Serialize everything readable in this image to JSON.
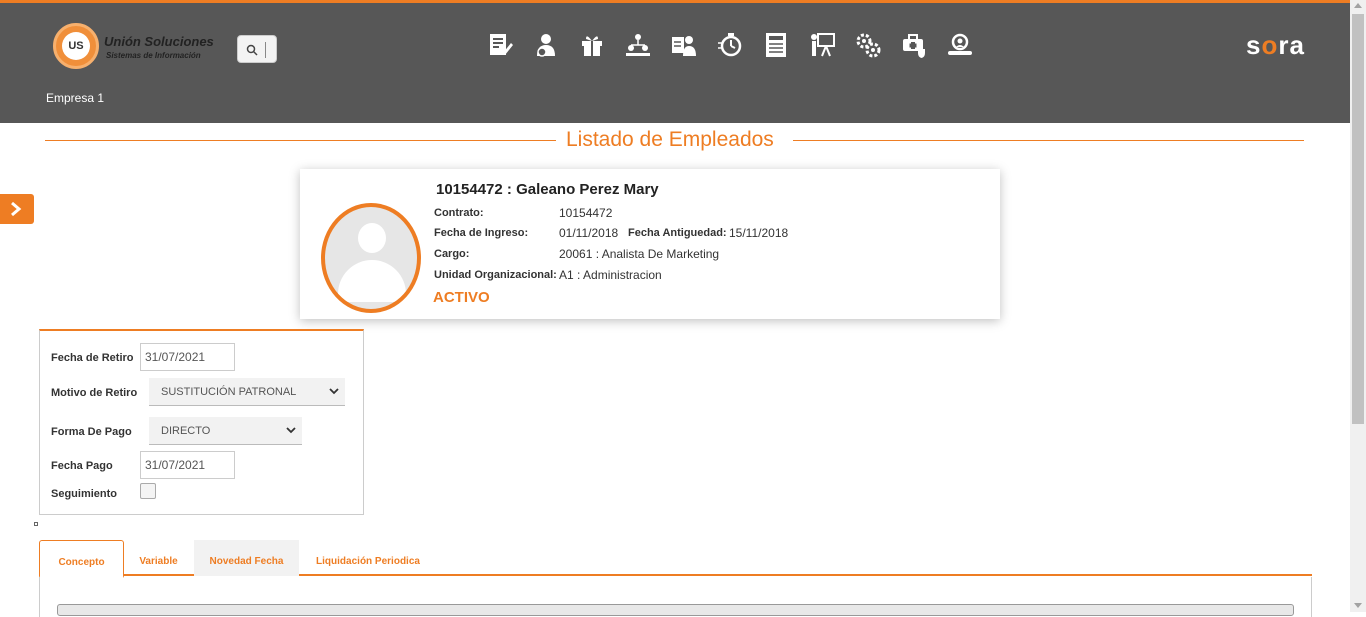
{
  "header": {
    "logo": {
      "brand_line1": "Unión Soluciones",
      "brand_line2": "Sistemas de Información",
      "mark": "US"
    },
    "search_icon": "search-icon",
    "nav_icons": [
      "document-edit-icon",
      "person-badge-icon",
      "gift-icon",
      "org-chart-icon",
      "employee-card-icon",
      "stopwatch-icon",
      "report-list-icon",
      "presentation-icon",
      "gears-icon",
      "medical-bag-icon",
      "people-search-icon"
    ],
    "product": {
      "prefix": "s",
      "accent": "o",
      "suffix": "ra"
    },
    "company": "Empresa 1",
    "accent_color": "#ee7d23",
    "bar_color": "#575757"
  },
  "page": {
    "title": "Listado de Empleados",
    "side_toggle_icon": "chevron-right-icon"
  },
  "employee": {
    "name": "10154472 : Galeano Perez Mary",
    "contract_label": "Contrato:",
    "contract_value": "10154472",
    "start_label": "Fecha de Ingreso:",
    "start_value": "01/11/2018",
    "seniority_label": "Fecha Antiguedad:",
    "seniority_value": "15/11/2018",
    "position_label": "Cargo:",
    "position_value": "20061 : Analista De Marketing",
    "unit_label": "Unidad Organizacional:",
    "unit_value": "A1 : Administracion",
    "status": "ACTIVO",
    "avatar_icon": "user-avatar-icon"
  },
  "form": {
    "retiro_date_label": "Fecha de Retiro",
    "retiro_date_value": "31/07/2021",
    "motivo_label": "Motivo de Retiro",
    "motivo_value": "SUSTITUCIÓN PATRONAL",
    "pago_label": "Forma De Pago",
    "pago_value": "DIRECTO",
    "fecha_pago_label": "Fecha Pago",
    "fecha_pago_value": "31/07/2021",
    "seguimiento_label": "Seguimiento",
    "seguimiento_checked": false
  },
  "tabs": [
    {
      "label": "Concepto",
      "active": true
    },
    {
      "label": "Variable",
      "active": false
    },
    {
      "label": "Novedad Fecha",
      "active": false
    },
    {
      "label": "Liquidación Periodica",
      "active": false
    }
  ]
}
